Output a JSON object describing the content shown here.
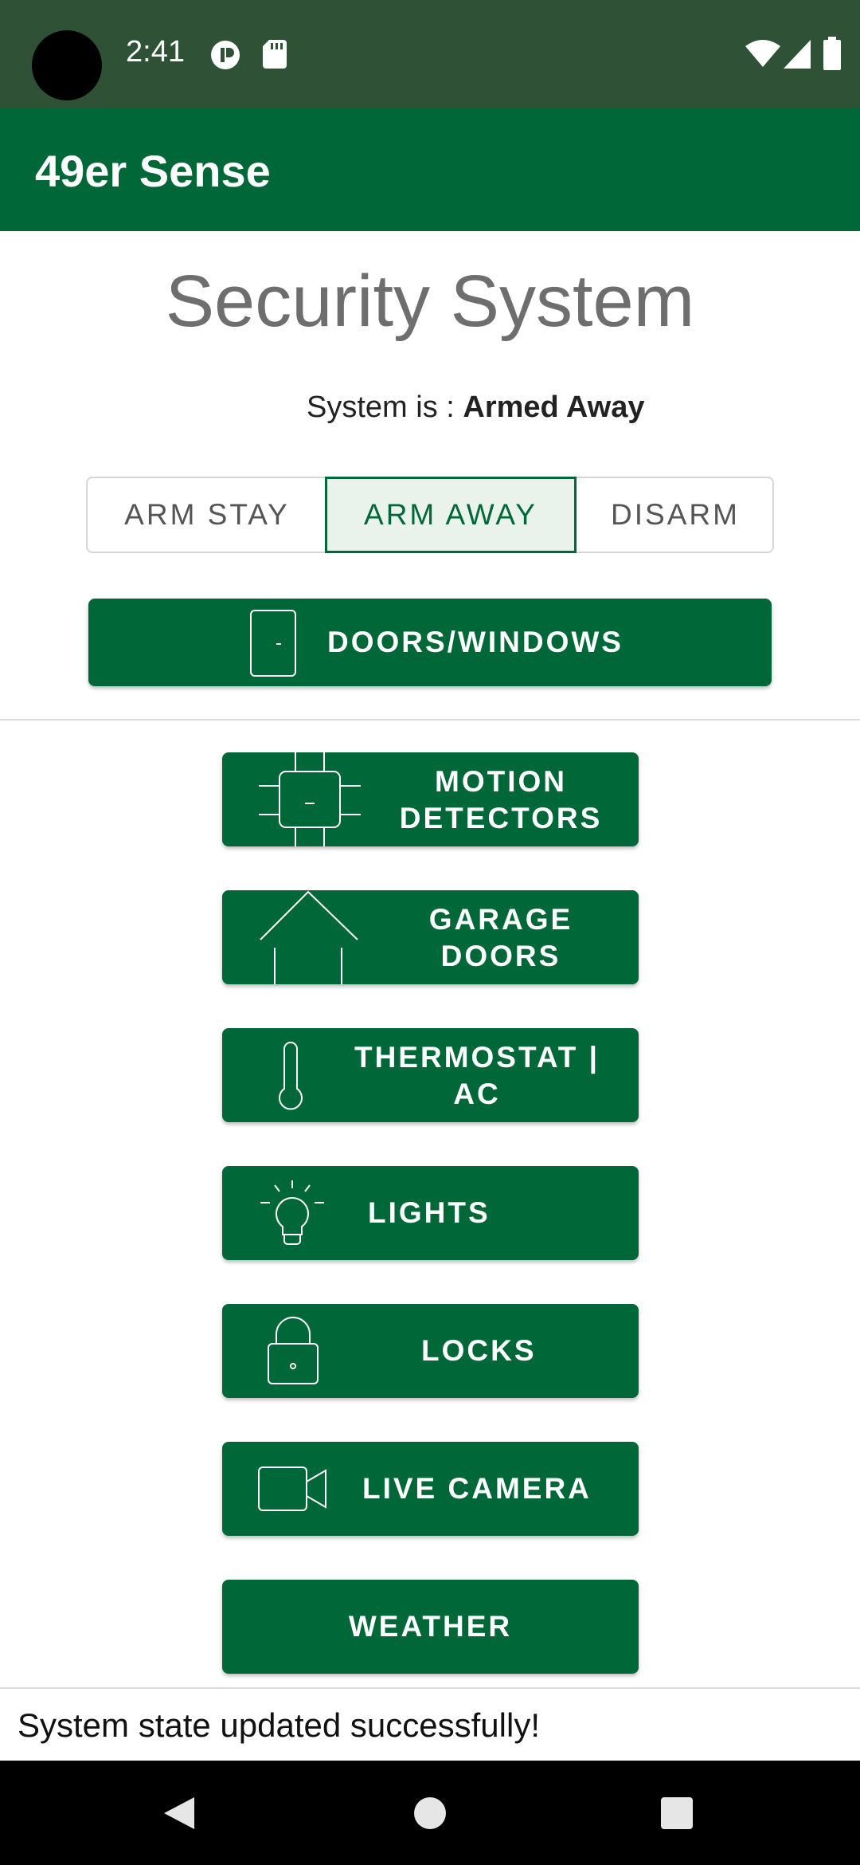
{
  "status_bar": {
    "time": "2:41",
    "icons": [
      "camera-cutout",
      "notification-icon",
      "sd-card-icon",
      "wifi-icon",
      "signal-icon",
      "battery-icon"
    ]
  },
  "app_bar": {
    "title": "49er Sense"
  },
  "page": {
    "title": "Security System",
    "system_prefix": "System is : ",
    "system_state": "Armed Away"
  },
  "mode_toggle": {
    "options": [
      "ARM STAY",
      "ARM AWAY",
      "DISARM"
    ],
    "selected": "ARM AWAY"
  },
  "buttons": {
    "doors_windows": "DOORS/WINDOWS",
    "motion_detectors": "MOTION\nDETECTORS",
    "garage_doors": "GARAGE\nDOORS",
    "thermostat": "THERMOSTAT |\nAC",
    "lights": "LIGHTS",
    "locks": "LOCKS",
    "live_camera": "LIVE CAMERA",
    "weather": "WEATHER"
  },
  "snackbar": {
    "message": "System state updated successfully!"
  },
  "colors": {
    "primary": "#006838",
    "status_bar": "#2f5236",
    "selected_bg": "#e9f3ec",
    "title_gray": "#6e6e6e"
  }
}
